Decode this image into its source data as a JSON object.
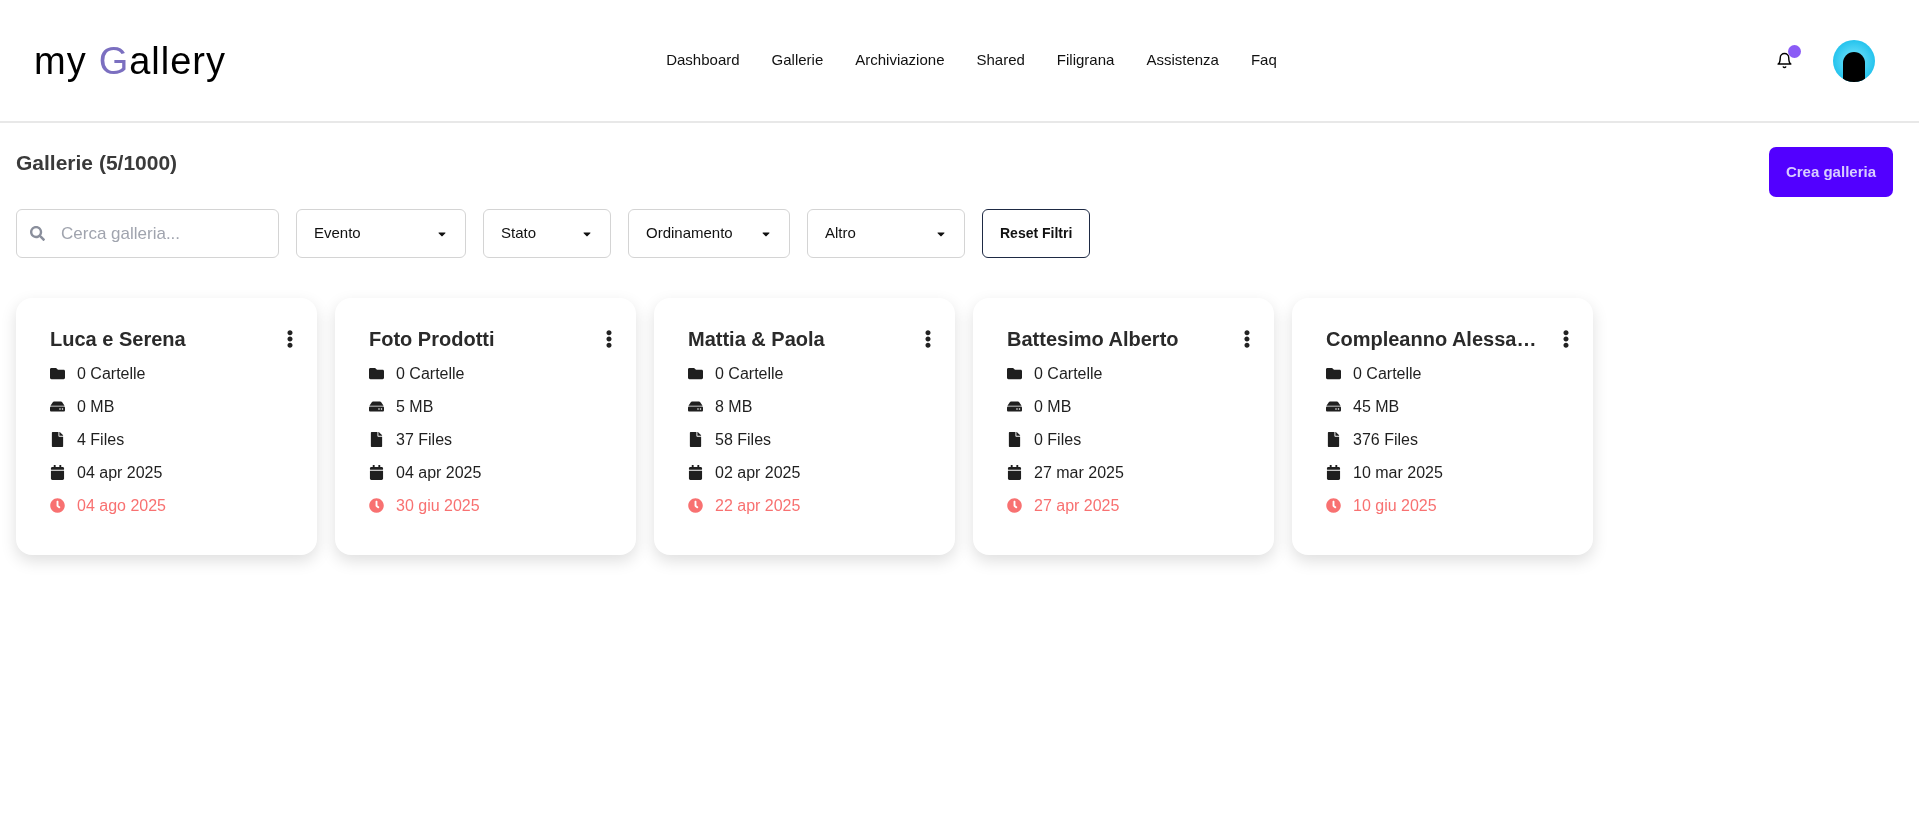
{
  "logo": {
    "prefix": "my",
    "initial": "G",
    "rest": "allery"
  },
  "nav": [
    "Dashboard",
    "Gallerie",
    "Archiviazione",
    "Shared",
    "Filigrana",
    "Assistenza",
    "Faq"
  ],
  "notifications": {
    "unread": true
  },
  "page": {
    "title": "Gallerie (5/1000)",
    "create_button": "Crea galleria"
  },
  "filters": {
    "search": {
      "placeholder": "Cerca galleria..."
    },
    "dropdowns": [
      "Evento",
      "Stato",
      "Ordinamento",
      "Altro"
    ],
    "reset": "Reset Filtri"
  },
  "galleries": [
    {
      "title": "Luca e Serena",
      "details": [
        {
          "kind": "folders",
          "text": "0 Cartelle"
        },
        {
          "kind": "size",
          "text": "0 MB"
        },
        {
          "kind": "files",
          "text": "4 Files"
        },
        {
          "kind": "date",
          "text": "04 apr 2025"
        },
        {
          "kind": "expiry",
          "text": "04 ago 2025"
        }
      ]
    },
    {
      "title": "Foto Prodotti",
      "details": [
        {
          "kind": "folders",
          "text": "0 Cartelle"
        },
        {
          "kind": "size",
          "text": "5 MB"
        },
        {
          "kind": "files",
          "text": "37 Files"
        },
        {
          "kind": "date",
          "text": "04 apr 2025"
        },
        {
          "kind": "expiry",
          "text": "30 giu 2025"
        }
      ]
    },
    {
      "title": "Mattia & Paola",
      "details": [
        {
          "kind": "folders",
          "text": "0 Cartelle"
        },
        {
          "kind": "size",
          "text": "8 MB"
        },
        {
          "kind": "files",
          "text": "58 Files"
        },
        {
          "kind": "date",
          "text": "02 apr 2025"
        },
        {
          "kind": "expiry",
          "text": "22 apr 2025"
        }
      ]
    },
    {
      "title": "Battesimo Alberto",
      "details": [
        {
          "kind": "folders",
          "text": "0 Cartelle"
        },
        {
          "kind": "size",
          "text": "0 MB"
        },
        {
          "kind": "files",
          "text": "0 Files"
        },
        {
          "kind": "date",
          "text": "27 mar 2025"
        },
        {
          "kind": "expiry",
          "text": "27 apr 2025"
        }
      ]
    },
    {
      "title": "Compleanno Alessa…",
      "details": [
        {
          "kind": "folders",
          "text": "0 Cartelle"
        },
        {
          "kind": "size",
          "text": "45 MB"
        },
        {
          "kind": "files",
          "text": "376 Files"
        },
        {
          "kind": "date",
          "text": "10 mar 2025"
        },
        {
          "kind": "expiry",
          "text": "10 giu 2025"
        }
      ]
    }
  ]
}
